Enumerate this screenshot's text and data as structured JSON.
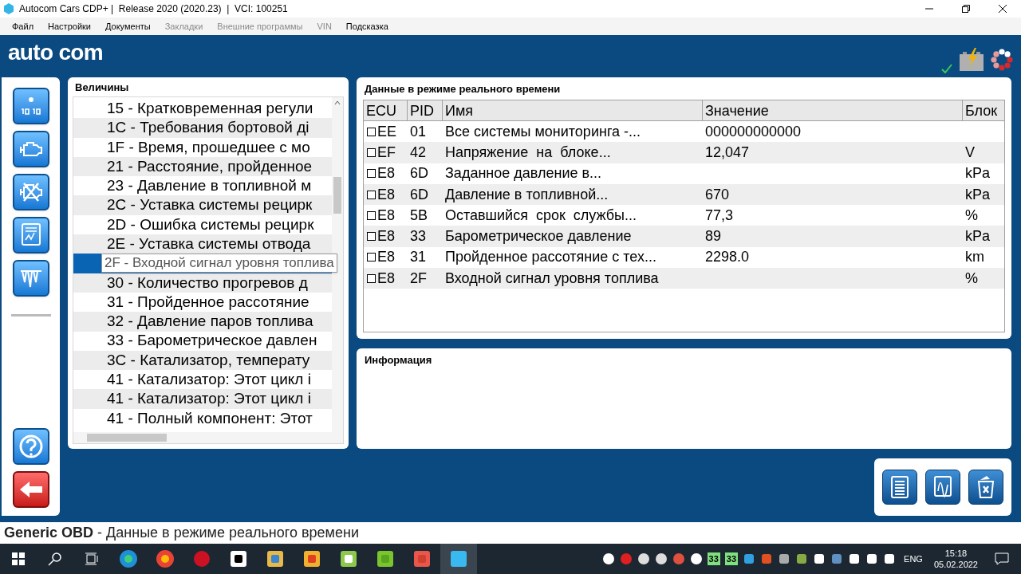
{
  "window": {
    "title": "Autocom Cars CDP+ |  Release 2020 (2020.23)  |  VCI: 100251"
  },
  "menu": [
    {
      "label": "Файл",
      "disabled": false
    },
    {
      "label": "Настройки",
      "disabled": false
    },
    {
      "label": "Документы",
      "disabled": false
    },
    {
      "label": "Закладки",
      "disabled": true
    },
    {
      "label": "Внешние программы",
      "disabled": true
    },
    {
      "label": "VIN",
      "disabled": true
    },
    {
      "label": "Подсказка",
      "disabled": false
    }
  ],
  "logo": "auto com",
  "tree": {
    "title": "Величины",
    "items": [
      {
        "label": "15 - Кратковременная регули",
        "selected": false
      },
      {
        "label": "1C - Требования бортовой ді",
        "selected": false
      },
      {
        "label": "1F - Время, прошедшее с мо",
        "selected": false
      },
      {
        "label": "21 - Расстояние, пройденное",
        "selected": false
      },
      {
        "label": "23 - Давление в топливной м",
        "selected": false
      },
      {
        "label": "2C - Уставка системы рецирк",
        "selected": false
      },
      {
        "label": "2D - Ошибка системы рецирк",
        "selected": false
      },
      {
        "label": "2E - Уставка системы отвода",
        "selected": false
      },
      {
        "selected": true,
        "tooltip": "2F - Входной сигнал уровня топлива"
      },
      {
        "label": "30 - Количество прогревов д",
        "selected": false
      },
      {
        "label": "31 - Пройденное рассотяние",
        "selected": false
      },
      {
        "label": "32 - Давление паров топлива",
        "selected": false
      },
      {
        "label": "33 - Барометрическое давлен",
        "selected": false
      },
      {
        "label": "3C - Катализатор, температу",
        "selected": false
      },
      {
        "label": "41 - Катализатор: Этот цикл і",
        "selected": false
      },
      {
        "label": "41 - Катализатор: Этот цикл і",
        "selected": false
      },
      {
        "label": "41 - Полный компонент: Этот",
        "selected": false
      }
    ]
  },
  "live": {
    "title": "Данные в режиме реального времени",
    "columns": [
      "ECU",
      "PID",
      "Имя",
      "Значение",
      "Блок"
    ],
    "rows": [
      {
        "checked": false,
        "ecu": "EE",
        "pid": "01",
        "name": "Все системы мониторинга -...",
        "value": "000000000000"
      },
      {
        "checked": false,
        "ecu": "EF",
        "pid": "42",
        "name": "Напряжение  на  блоке...",
        "value": "12,047",
        "unit": "V"
      },
      {
        "checked": false,
        "ecu": "E8",
        "pid": "6D",
        "name": "Заданное давление в...",
        "unit": "kPa"
      },
      {
        "checked": false,
        "ecu": "E8",
        "pid": "6D",
        "name": "Давление в топливной...",
        "value": "670",
        "unit": "kPa"
      },
      {
        "checked": false,
        "ecu": "E8",
        "pid": "5B",
        "name": "Оставшийся  срок  службы...",
        "value": "77,3",
        "unit": "%"
      },
      {
        "checked": false,
        "ecu": "E8",
        "pid": "33",
        "name": "Барометрическое давление",
        "value": "89",
        "unit": "kPa"
      },
      {
        "checked": false,
        "ecu": "E8",
        "pid": "31",
        "name": "Пройденное рассотяние с тех...",
        "value": "2298.0",
        "unit": "km"
      },
      {
        "checked": false,
        "ecu": "E8",
        "pid": "2F",
        "name": "Входной сигнал уровня топлива",
        "unit": "%"
      }
    ]
  },
  "info": {
    "title": "Информация"
  },
  "status": {
    "prefix": "Generic OBD",
    "text": " - Данные в режиме реального времени"
  },
  "taskbar": {
    "tray_counters": [
      "33",
      "33"
    ],
    "language": "ENG",
    "time": "15:18",
    "date": "05.02.2022"
  }
}
